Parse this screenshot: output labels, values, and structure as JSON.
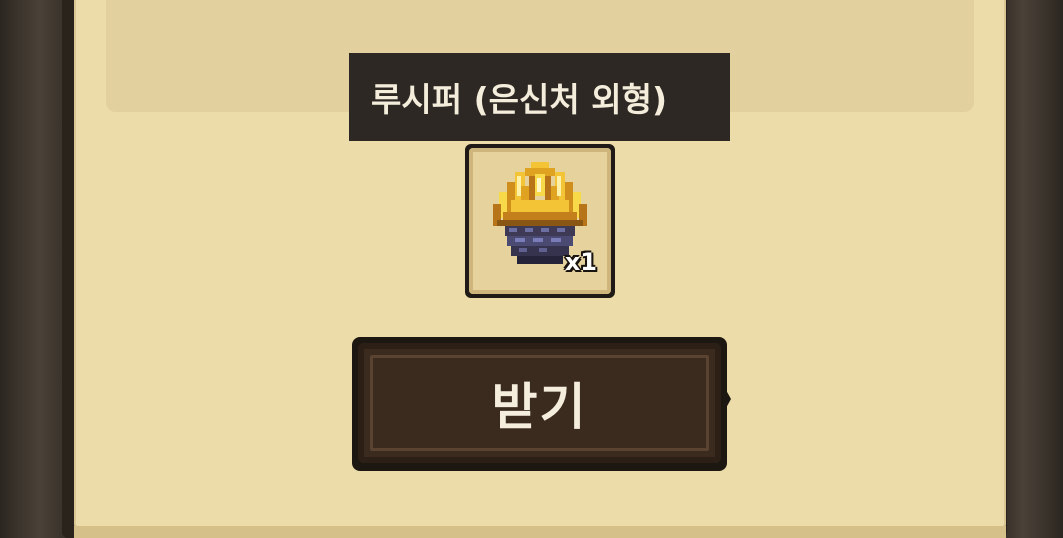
{
  "tooltip": {
    "item_name": "루시퍼 (은신처 외형)"
  },
  "reward": {
    "icon": "lucifer-golden-crown-icon",
    "quantity_label": "x1"
  },
  "actions": {
    "receive_label": "받기"
  },
  "colors": {
    "parchment": "#ecdca9",
    "tooltip_bg": "#2d2823",
    "button_bg": "#3b2a1e",
    "frame": "#3a342d"
  }
}
